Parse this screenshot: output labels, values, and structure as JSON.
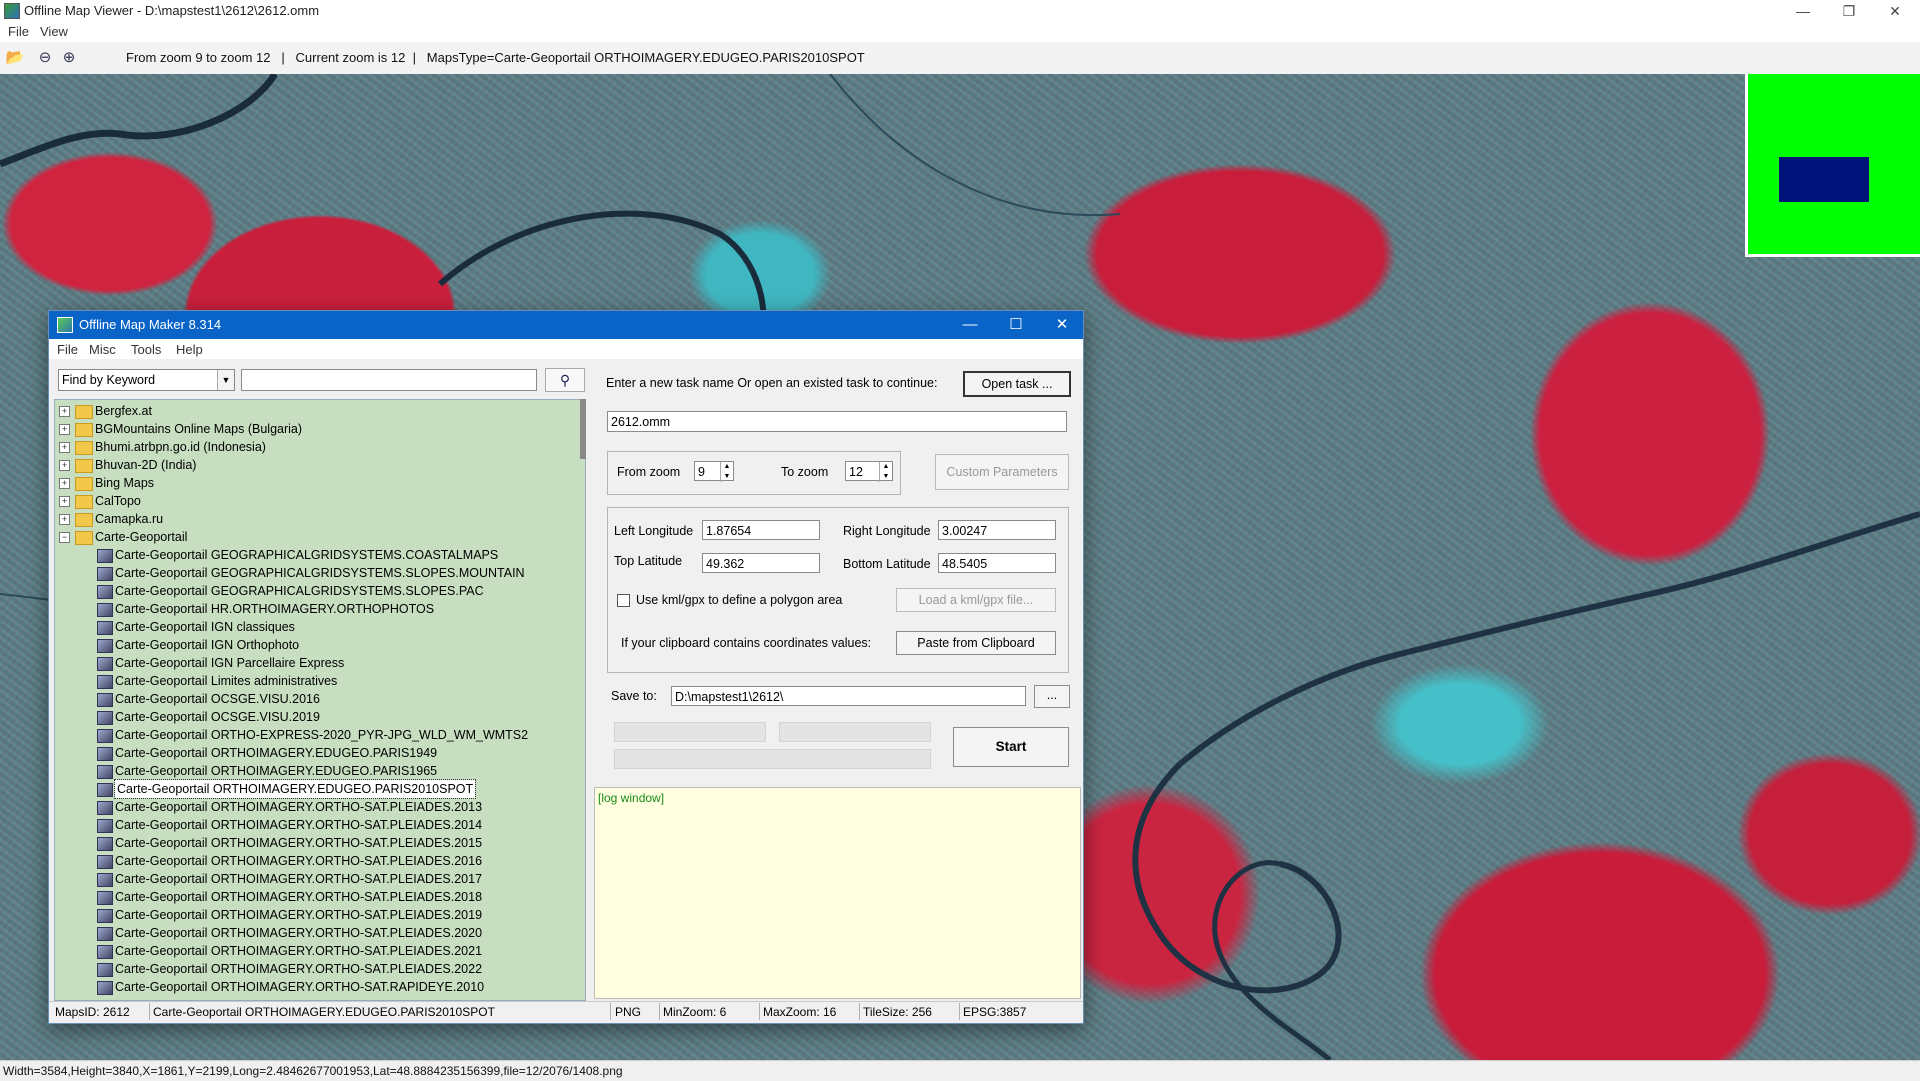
{
  "outer": {
    "title": "Offline Map Viewer - D:\\mapstest1\\2612\\2612.omm",
    "menu": [
      "File",
      "View"
    ],
    "toolbar_status": "From zoom 9 to zoom 12   |   Current zoom is 12  |   MapsType=Carte-Geoportail ORTHOIMAGERY.EDUGEO.PARIS2010SPOT",
    "status_bar": "Width=3584,Height=3840,X=1861,Y=2199,Long=2.48462677001953,Lat=48.8884235156399,file=12/2076/1408.png"
  },
  "dialog": {
    "title": "Offline Map Maker 8.314",
    "menu": [
      "File",
      "Misc",
      "Tools",
      "Help"
    ],
    "find_mode": "Find by Keyword",
    "search_value": "",
    "tree": {
      "folders_top": [
        "Bergfex.at",
        "BGMountains Online Maps (Bulgaria)",
        "Bhumi.atrbpn.go.id (Indonesia)",
        "Bhuvan-2D (India)",
        "Bing Maps",
        "CalTopo",
        "Camapka.ru"
      ],
      "open_folder": "Carte-Geoportail",
      "children": [
        "Carte-Geoportail GEOGRAPHICALGRIDSYSTEMS.COASTALMAPS",
        "Carte-Geoportail GEOGRAPHICALGRIDSYSTEMS.SLOPES.MOUNTAIN",
        "Carte-Geoportail GEOGRAPHICALGRIDSYSTEMS.SLOPES.PAC",
        "Carte-Geoportail HR.ORTHOIMAGERY.ORTHOPHOTOS",
        "Carte-Geoportail IGN classiques",
        "Carte-Geoportail IGN Orthophoto",
        "Carte-Geoportail IGN Parcellaire Express",
        "Carte-Geoportail Limites administratives",
        "Carte-Geoportail OCSGE.VISU.2016",
        "Carte-Geoportail OCSGE.VISU.2019",
        "Carte-Geoportail ORTHO-EXPRESS-2020_PYR-JPG_WLD_WM_WMTS2",
        "Carte-Geoportail ORTHOIMAGERY.EDUGEO.PARIS1949",
        "Carte-Geoportail ORTHOIMAGERY.EDUGEO.PARIS1965",
        "Carte-Geoportail ORTHOIMAGERY.EDUGEO.PARIS2010SPOT",
        "Carte-Geoportail ORTHOIMAGERY.ORTHO-SAT.PLEIADES.2013",
        "Carte-Geoportail ORTHOIMAGERY.ORTHO-SAT.PLEIADES.2014",
        "Carte-Geoportail ORTHOIMAGERY.ORTHO-SAT.PLEIADES.2015",
        "Carte-Geoportail ORTHOIMAGERY.ORTHO-SAT.PLEIADES.2016",
        "Carte-Geoportail ORTHOIMAGERY.ORTHO-SAT.PLEIADES.2017",
        "Carte-Geoportail ORTHOIMAGERY.ORTHO-SAT.PLEIADES.2018",
        "Carte-Geoportail ORTHOIMAGERY.ORTHO-SAT.PLEIADES.2019",
        "Carte-Geoportail ORTHOIMAGERY.ORTHO-SAT.PLEIADES.2020",
        "Carte-Geoportail ORTHOIMAGERY.ORTHO-SAT.PLEIADES.2021",
        "Carte-Geoportail ORTHOIMAGERY.ORTHO-SAT.PLEIADES.2022",
        "Carte-Geoportail ORTHOIMAGERY.ORTHO-SAT.RAPIDEYE.2010"
      ],
      "selected_child": "Carte-Geoportail ORTHOIMAGERY.EDUGEO.PARIS2010SPOT"
    },
    "task_prompt": "Enter a new task name Or open an existed task to continue:",
    "open_task_label": "Open task ...",
    "task_name": "2612.omm",
    "from_zoom_label": "From zoom",
    "from_zoom": "9",
    "to_zoom_label": "To zoom",
    "to_zoom": "12",
    "custom_params_label": "Custom Parameters",
    "left_lon_label": "Left Longitude",
    "left_lon": "1.87654",
    "right_lon_label": "Right Longitude",
    "right_lon": "3.00247",
    "top_lat_label": "Top Latitude",
    "top_lat": "49.362",
    "bottom_lat_label": "Bottom Latitude",
    "bottom_lat": "48.5405",
    "kml_checkbox_label": "Use kml/gpx to define a polygon area",
    "load_kml_label": "Load a kml/gpx file...",
    "clipboard_text": "If your clipboard contains coordinates values:",
    "paste_label": "Paste from Clipboard",
    "save_to_label": "Save to:",
    "save_to": "D:\\mapstest1\\2612\\",
    "browse_label": "...",
    "start_label": "Start",
    "log_text": "[log window]",
    "status": {
      "maps_id": "MapsID: 2612",
      "map_name": "Carte-Geoportail ORTHOIMAGERY.EDUGEO.PARIS2010SPOT",
      "format": "PNG",
      "min_zoom": "MinZoom: 6",
      "max_zoom": "MaxZoom: 16",
      "tile_size": "TileSize: 256",
      "epsg": "EPSG:3857"
    }
  },
  "colors": {
    "titlebar_blue": "#0a64c8",
    "tree_bg": "#c7dfc0",
    "log_bg": "#ffffe0",
    "minimap_bg": "#00ff00",
    "minimap_view": "#00137a"
  }
}
